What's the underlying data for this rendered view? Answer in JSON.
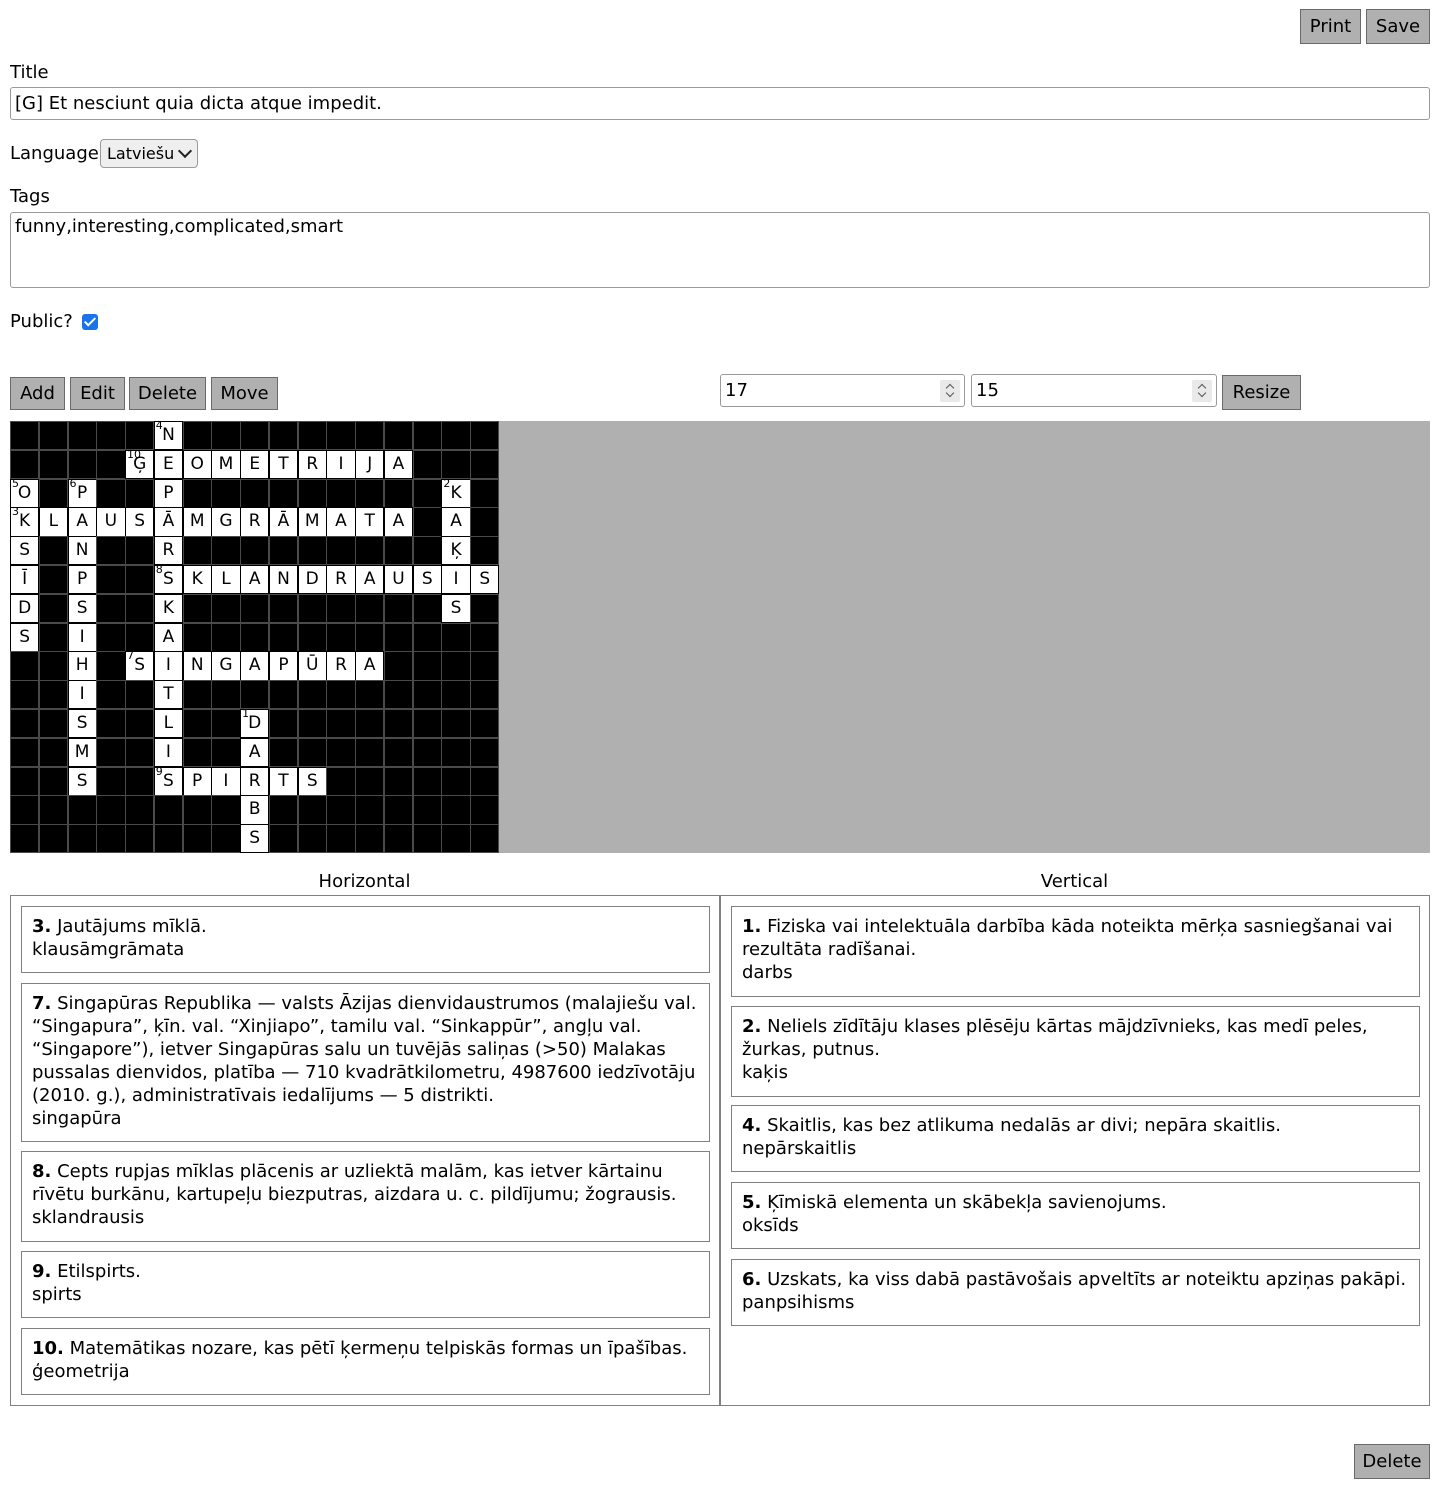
{
  "toolbar": {
    "print_label": "Print",
    "save_label": "Save"
  },
  "form": {
    "title_label": "Title",
    "title_value": "[G] Et nesciunt quia dicta atque impedit.",
    "language_label": "Language",
    "language_value": "Latviešu",
    "tags_label": "Tags",
    "tags_value": "funny,interesting,complicated,smart",
    "public_label": "Public?",
    "public_checked": true
  },
  "editor": {
    "add_label": "Add",
    "edit_label": "Edit",
    "delete_label": "Delete",
    "move_label": "Move",
    "width_value": "17",
    "height_value": "15",
    "resize_label": "Resize"
  },
  "grid": {
    "cols": 17,
    "rows": 15,
    "cells": [
      {
        "r": 0,
        "c": 5,
        "ch": "N",
        "n": "4"
      },
      {
        "r": 1,
        "c": 4,
        "ch": "Ģ",
        "n": "10"
      },
      {
        "r": 1,
        "c": 5,
        "ch": "E"
      },
      {
        "r": 1,
        "c": 6,
        "ch": "O"
      },
      {
        "r": 1,
        "c": 7,
        "ch": "M"
      },
      {
        "r": 1,
        "c": 8,
        "ch": "E"
      },
      {
        "r": 1,
        "c": 9,
        "ch": "T"
      },
      {
        "r": 1,
        "c": 10,
        "ch": "R"
      },
      {
        "r": 1,
        "c": 11,
        "ch": "I"
      },
      {
        "r": 1,
        "c": 12,
        "ch": "J"
      },
      {
        "r": 1,
        "c": 13,
        "ch": "A"
      },
      {
        "r": 2,
        "c": 0,
        "ch": "O",
        "n": "5"
      },
      {
        "r": 2,
        "c": 2,
        "ch": "P",
        "n": "6"
      },
      {
        "r": 2,
        "c": 5,
        "ch": "P"
      },
      {
        "r": 2,
        "c": 15,
        "ch": "K",
        "n": "2"
      },
      {
        "r": 3,
        "c": 0,
        "ch": "K",
        "n": "3"
      },
      {
        "r": 3,
        "c": 1,
        "ch": "L"
      },
      {
        "r": 3,
        "c": 2,
        "ch": "A"
      },
      {
        "r": 3,
        "c": 3,
        "ch": "U"
      },
      {
        "r": 3,
        "c": 4,
        "ch": "S"
      },
      {
        "r": 3,
        "c": 5,
        "ch": "Ā"
      },
      {
        "r": 3,
        "c": 6,
        "ch": "M"
      },
      {
        "r": 3,
        "c": 7,
        "ch": "G"
      },
      {
        "r": 3,
        "c": 8,
        "ch": "R"
      },
      {
        "r": 3,
        "c": 9,
        "ch": "Ā"
      },
      {
        "r": 3,
        "c": 10,
        "ch": "M"
      },
      {
        "r": 3,
        "c": 11,
        "ch": "A"
      },
      {
        "r": 3,
        "c": 12,
        "ch": "T"
      },
      {
        "r": 3,
        "c": 13,
        "ch": "A"
      },
      {
        "r": 3,
        "c": 15,
        "ch": "A"
      },
      {
        "r": 4,
        "c": 0,
        "ch": "S"
      },
      {
        "r": 4,
        "c": 2,
        "ch": "N"
      },
      {
        "r": 4,
        "c": 5,
        "ch": "R"
      },
      {
        "r": 4,
        "c": 15,
        "ch": "Ķ"
      },
      {
        "r": 5,
        "c": 0,
        "ch": "Ī"
      },
      {
        "r": 5,
        "c": 2,
        "ch": "P"
      },
      {
        "r": 5,
        "c": 5,
        "ch": "S",
        "n": "8"
      },
      {
        "r": 5,
        "c": 6,
        "ch": "K"
      },
      {
        "r": 5,
        "c": 7,
        "ch": "L"
      },
      {
        "r": 5,
        "c": 8,
        "ch": "A"
      },
      {
        "r": 5,
        "c": 9,
        "ch": "N"
      },
      {
        "r": 5,
        "c": 10,
        "ch": "D"
      },
      {
        "r": 5,
        "c": 11,
        "ch": "R"
      },
      {
        "r": 5,
        "c": 12,
        "ch": "A"
      },
      {
        "r": 5,
        "c": 13,
        "ch": "U"
      },
      {
        "r": 5,
        "c": 14,
        "ch": "S"
      },
      {
        "r": 5,
        "c": 15,
        "ch": "I"
      },
      {
        "r": 5,
        "c": 16,
        "ch": "S"
      },
      {
        "r": 6,
        "c": 0,
        "ch": "D"
      },
      {
        "r": 6,
        "c": 2,
        "ch": "S"
      },
      {
        "r": 6,
        "c": 5,
        "ch": "K"
      },
      {
        "r": 6,
        "c": 15,
        "ch": "S"
      },
      {
        "r": 7,
        "c": 0,
        "ch": "S"
      },
      {
        "r": 7,
        "c": 2,
        "ch": "I"
      },
      {
        "r": 7,
        "c": 5,
        "ch": "A"
      },
      {
        "r": 8,
        "c": 2,
        "ch": "H"
      },
      {
        "r": 8,
        "c": 4,
        "ch": "S",
        "n": "7"
      },
      {
        "r": 8,
        "c": 5,
        "ch": "I"
      },
      {
        "r": 8,
        "c": 6,
        "ch": "N"
      },
      {
        "r": 8,
        "c": 7,
        "ch": "G"
      },
      {
        "r": 8,
        "c": 8,
        "ch": "A"
      },
      {
        "r": 8,
        "c": 9,
        "ch": "P"
      },
      {
        "r": 8,
        "c": 10,
        "ch": "Ū"
      },
      {
        "r": 8,
        "c": 11,
        "ch": "R"
      },
      {
        "r": 8,
        "c": 12,
        "ch": "A"
      },
      {
        "r": 9,
        "c": 2,
        "ch": "I"
      },
      {
        "r": 9,
        "c": 5,
        "ch": "T"
      },
      {
        "r": 10,
        "c": 2,
        "ch": "S"
      },
      {
        "r": 10,
        "c": 5,
        "ch": "L"
      },
      {
        "r": 10,
        "c": 8,
        "ch": "D",
        "n": "1"
      },
      {
        "r": 11,
        "c": 2,
        "ch": "M"
      },
      {
        "r": 11,
        "c": 5,
        "ch": "I"
      },
      {
        "r": 11,
        "c": 8,
        "ch": "A"
      },
      {
        "r": 12,
        "c": 2,
        "ch": "S"
      },
      {
        "r": 12,
        "c": 5,
        "ch": "S",
        "n": "9"
      },
      {
        "r": 12,
        "c": 6,
        "ch": "P"
      },
      {
        "r": 12,
        "c": 7,
        "ch": "I"
      },
      {
        "r": 12,
        "c": 8,
        "ch": "R"
      },
      {
        "r": 12,
        "c": 9,
        "ch": "T"
      },
      {
        "r": 12,
        "c": 10,
        "ch": "S"
      },
      {
        "r": 13,
        "c": 8,
        "ch": "B"
      },
      {
        "r": 14,
        "c": 8,
        "ch": "S"
      }
    ]
  },
  "clues": {
    "horizontal_title": "Horizontal",
    "vertical_title": "Vertical",
    "horizontal": [
      {
        "num": "3.",
        "text": "Jautājums mīklā.",
        "answer": "klausāmgrāmata"
      },
      {
        "num": "7.",
        "text": "Singapūras Republika — valsts Āzijas dienvidaustrumos (malajiešu val. “Singapura”, ķīn. val. “Xinjiapo”, tamilu val. “Sinkappūr”, angļu val. “Singapore”), ietver Singapūras salu un tuvējās saliņas (>50) Malakas pus­salas dienvidos, platība — 710 kvadrātkilometru, 4987600 iedzīvotāju (2010. g.), administratīvais iedalījums — 5 distrikti.",
        "answer": "singapūra"
      },
      {
        "num": "8.",
        "text": "Cepts rupjas mīklas plācenis ar uzliektā malām, kas ietver kārtainu rīvētu burkānu, kartupeļu biezputras, aizdara u. c. pildījumu; žograusis.",
        "answer": "sklandrausis"
      },
      {
        "num": "9.",
        "text": "Etilspirts.",
        "answer": "spirts"
      },
      {
        "num": "10.",
        "text": "Matemātikas nozare, kas pētī ķermeņu telpiskās formas un īpašības.",
        "answer": "ģeometrija"
      }
    ],
    "vertical": [
      {
        "num": "1.",
        "text": "Fiziska vai intelektuāla darbība kāda noteikta mērķa sasniegšanai vai rezultāta radīšanai.",
        "answer": "darbs"
      },
      {
        "num": "2.",
        "text": "Neliels zīdītāju klases plēsēju kārtas mājdzīvnieks, kas medī peles, žurkas, putnus.",
        "answer": "kaķis"
      },
      {
        "num": "4.",
        "text": "Skaitlis, kas bez atlikuma nedalās ar divi; nepāra skaitlis.",
        "answer": "nepārskaitlis"
      },
      {
        "num": "5.",
        "text": "Ķīmiskā elementa un skābekļa savienojums.",
        "answer": "oksīds"
      },
      {
        "num": "6.",
        "text": "Uzskats, ka viss dabā pastāvošais apveltīts ar noteiktu apziņas pakāpi.",
        "answer": "panpsihisms"
      }
    ]
  },
  "footer": {
    "delete_label": "Delete"
  }
}
